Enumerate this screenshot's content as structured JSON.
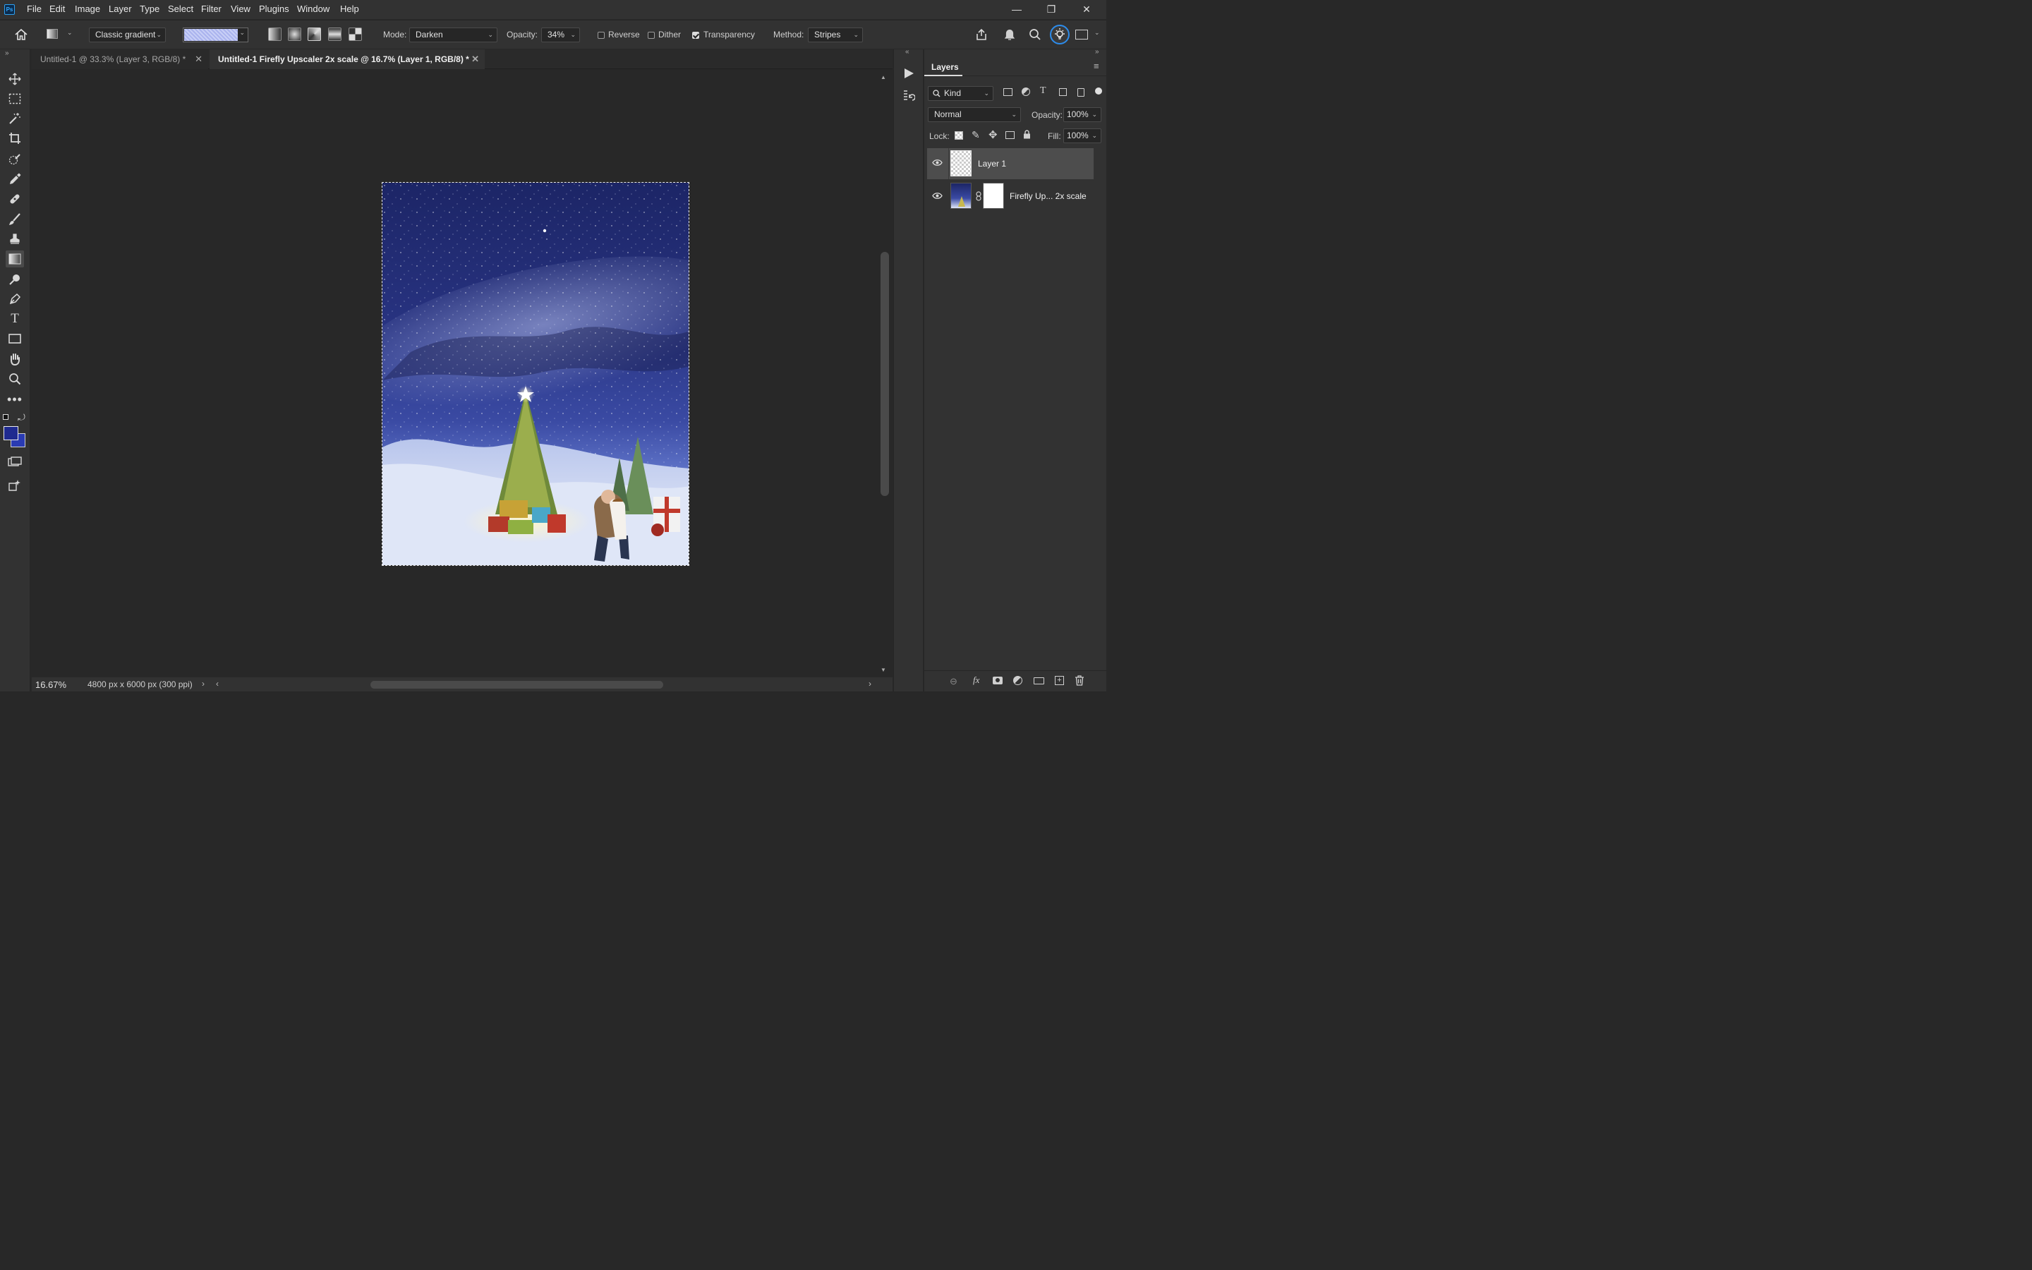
{
  "app": {
    "logo": "Ps"
  },
  "menu": [
    "File",
    "Edit",
    "Image",
    "Layer",
    "Type",
    "Select",
    "Filter",
    "View",
    "Plugins",
    "Window",
    "Help"
  ],
  "window_controls": {
    "minimize": "—",
    "restore": "❐",
    "close": "✕"
  },
  "options": {
    "gradient_preset": "Classic gradient",
    "mode_label": "Mode:",
    "mode_value": "Darken",
    "opacity_label": "Opacity:",
    "opacity_value": "34%",
    "reverse_label": "Reverse",
    "reverse_checked": false,
    "dither_label": "Dither",
    "dither_checked": false,
    "transparency_label": "Transparency",
    "transparency_checked": true,
    "method_label": "Method:",
    "method_value": "Stripes",
    "swatch_color": "#b9c1f2"
  },
  "tabs": [
    {
      "label": "Untitled-1 @ 33.3% (Layer 3, RGB/8) *",
      "active": false
    },
    {
      "label": "Untitled-1 Firefly Upscaler 2x scale @ 16.7% (Layer 1, RGB/8) *",
      "active": true
    }
  ],
  "tools": [
    "move-icon",
    "marquee-icon",
    "magic-wand-icon",
    "crop-icon",
    "object-select-icon",
    "eyedropper-icon",
    "healing-brush-icon",
    "brush-icon",
    "stamp-icon",
    "gradient-icon",
    "dodge-icon",
    "pen-icon",
    "type-icon",
    "rectangle-icon",
    "hand-icon",
    "zoom-icon",
    "more-tools-icon"
  ],
  "colors": {
    "foreground": "#1f2a8f",
    "background": "#2a3bb3",
    "accent": "#2d8ceb"
  },
  "layers_panel": {
    "title": "Layers",
    "filter_kind": "Kind",
    "blend_mode": "Normal",
    "opacity_label": "Opacity:",
    "opacity_value": "100%",
    "lock_label": "Lock:",
    "fill_label": "Fill:",
    "fill_value": "100%",
    "layers": [
      {
        "name": "Layer 1",
        "visible": true,
        "selected": true
      },
      {
        "name": "Firefly Up... 2x scale",
        "visible": true,
        "selected": false
      }
    ]
  },
  "status": {
    "zoom": "16.67%",
    "doc_info": "4800 px x 6000 px (300 ppi)"
  }
}
